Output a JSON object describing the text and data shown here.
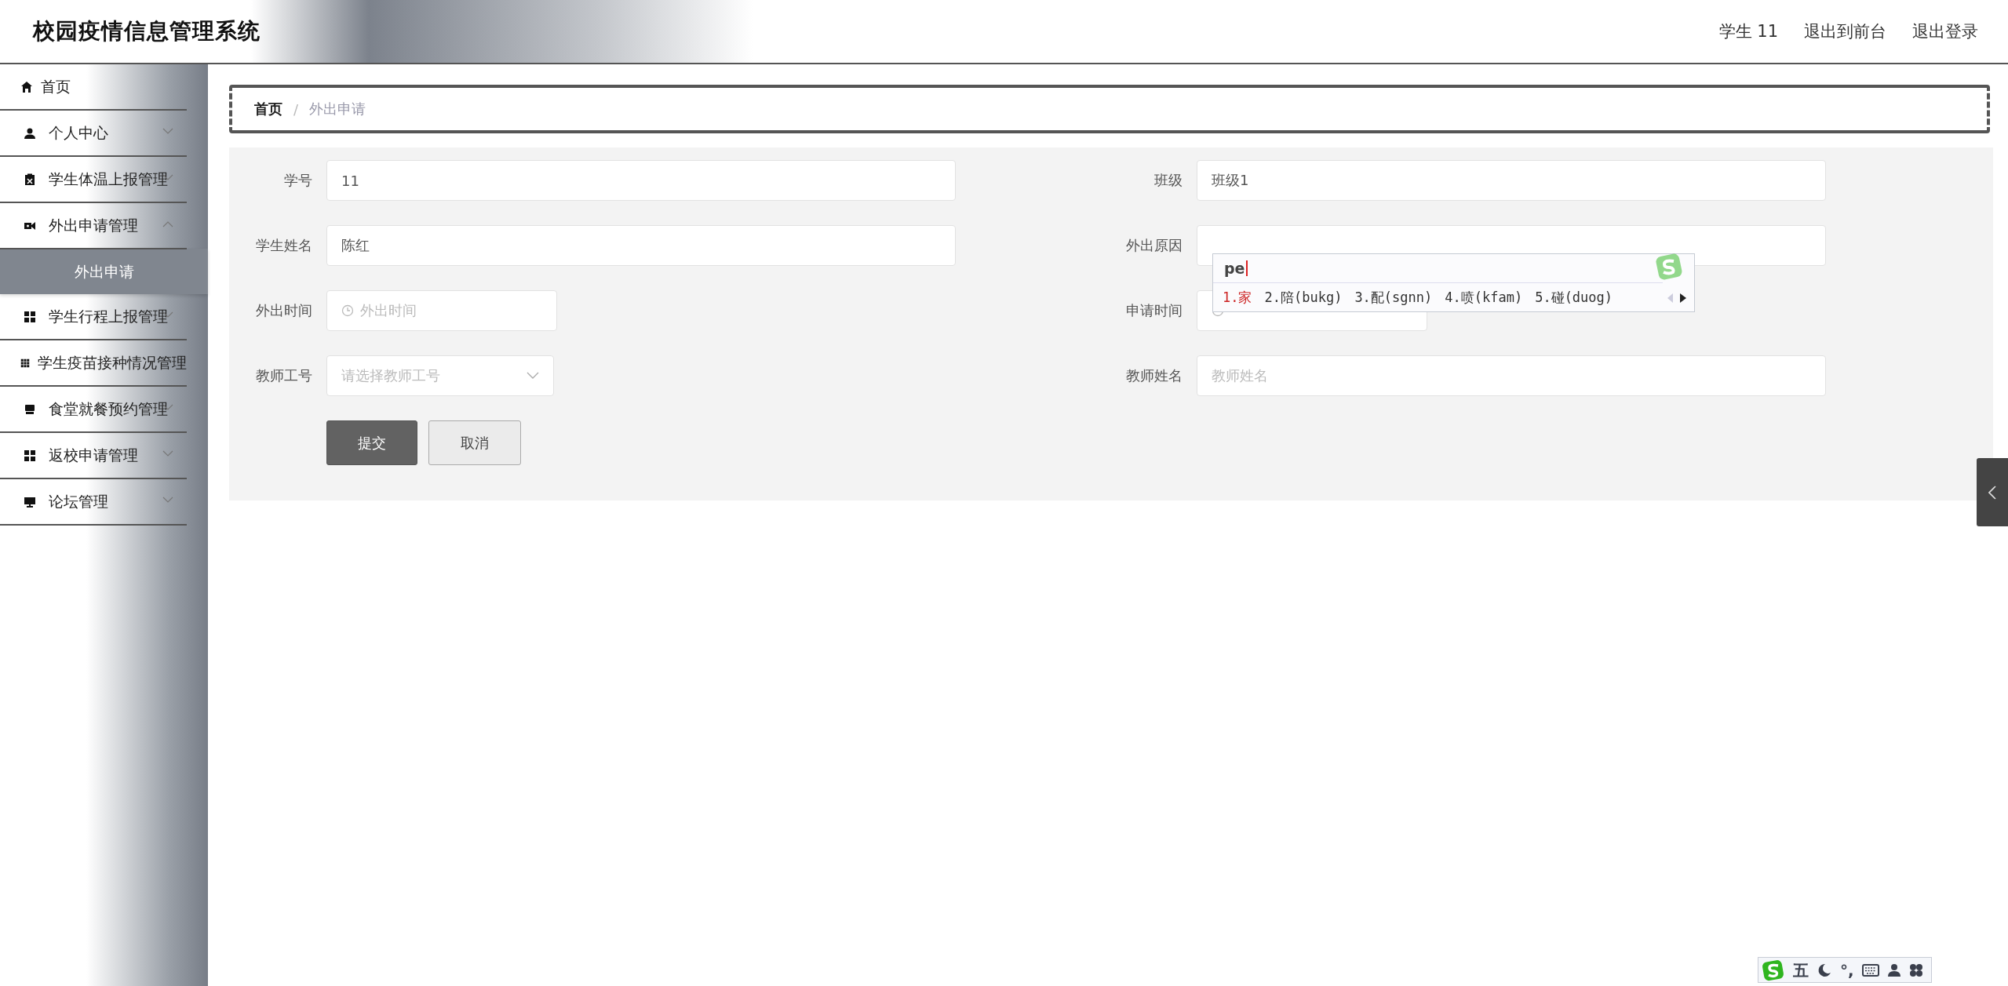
{
  "header": {
    "title": "校园疫情信息管理系统",
    "user": "学生 11",
    "links": [
      "退出到前台",
      "退出登录"
    ]
  },
  "sidebar": {
    "items": [
      {
        "label": "首页",
        "kind": "home",
        "expandable": false
      },
      {
        "label": "个人中心",
        "kind": "user",
        "expandable": true,
        "expanded": false
      },
      {
        "label": "学生体温上报管理",
        "kind": "clipboard",
        "expandable": true,
        "expanded": false
      },
      {
        "label": "外出申请管理",
        "kind": "camera",
        "expandable": true,
        "expanded": true,
        "children": [
          {
            "label": "外出申请",
            "selected": true
          }
        ]
      },
      {
        "label": "学生行程上报管理",
        "kind": "grid",
        "expandable": true,
        "expanded": false
      },
      {
        "label": "学生疫苗接种情况管理",
        "kind": "grid9",
        "expandable": false
      },
      {
        "label": "食堂就餐预约管理",
        "kind": "tray",
        "expandable": true,
        "expanded": false
      },
      {
        "label": "返校申请管理",
        "kind": "grid",
        "expandable": true,
        "expanded": false
      },
      {
        "label": "论坛管理",
        "kind": "monitor",
        "expandable": true,
        "expanded": false
      }
    ]
  },
  "breadcrumb": {
    "separator": "/",
    "items": [
      {
        "label": "首页",
        "current": false
      },
      {
        "label": "外出申请",
        "current": true
      }
    ]
  },
  "form": {
    "fields": [
      {
        "label": "学号",
        "kind": "text",
        "value": "11"
      },
      {
        "label": "班级",
        "kind": "text",
        "value": "班级1"
      },
      {
        "label": "学生姓名",
        "kind": "text",
        "value": "陈红"
      },
      {
        "label": "外出原因",
        "kind": "text"
      },
      {
        "label": "外出时间",
        "kind": "date",
        "placeholder": "外出时间"
      },
      {
        "label": "申请时间",
        "kind": "date"
      },
      {
        "label": "教师工号",
        "kind": "select",
        "placeholder": "请选择教师工号"
      },
      {
        "label": "教师姓名",
        "kind": "text",
        "placeholder": "教师姓名"
      }
    ],
    "buttons": [
      {
        "label": "提交",
        "kind": "primary"
      },
      {
        "label": "取消",
        "kind": "default"
      }
    ]
  },
  "ime": {
    "composition": "pe",
    "candidates": [
      {
        "label": "1.家",
        "selected": true
      },
      {
        "label": "2.陪(bukg)",
        "selected": false
      },
      {
        "label": "3.配(sgnn)",
        "selected": false
      },
      {
        "label": "4.喷(kfam)",
        "selected": false
      },
      {
        "label": "5.碰(duog)",
        "selected": false
      }
    ]
  },
  "ime_toolbar": {
    "mode": "五",
    "punctuation": "°,"
  }
}
